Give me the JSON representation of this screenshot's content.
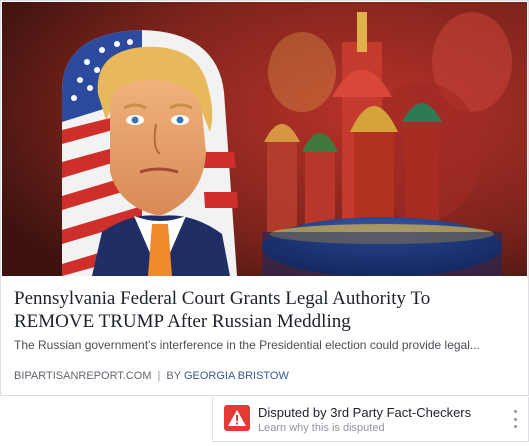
{
  "article": {
    "headline_line1": "Pennsylvania Federal Court Grants Legal Authority To",
    "headline_line2": "REMOVE TRUMP After Russian Meddling",
    "description": "The Russian government's interference in the Presidential election could provide legal...",
    "source": "BIPARTISANREPORT.COM",
    "separator": "|",
    "by_prefix": "BY",
    "author": "GEORGIA BRISTOW"
  },
  "dispute_notice": {
    "title": "Disputed by 3rd Party Fact-Checkers",
    "subtitle": "Learn why this is disputed",
    "icon": "warning-icon",
    "accent_color": "#e53935"
  },
  "colors": {
    "headline": "#1d2129",
    "link": "#365899",
    "muted": "#606770"
  }
}
